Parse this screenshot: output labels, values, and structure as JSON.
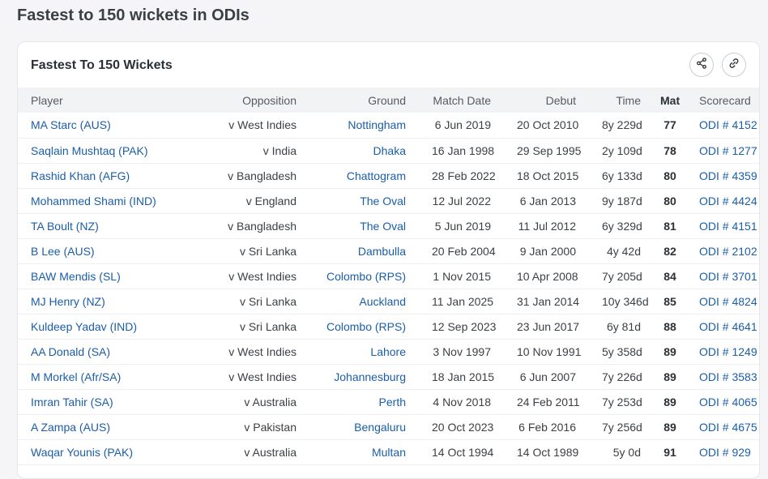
{
  "page": {
    "title": "Fastest to 150 wickets in ODIs"
  },
  "card": {
    "title": "Fastest To 150 Wickets"
  },
  "columns": {
    "player": "Player",
    "opposition": "Opposition",
    "ground": "Ground",
    "match_date": "Match Date",
    "debut": "Debut",
    "time": "Time",
    "mat": "Mat",
    "scorecard": "Scorecard"
  },
  "rows": [
    {
      "player": "MA Starc (AUS)",
      "opposition": "v West Indies",
      "ground": "Nottingham",
      "match_date": "6 Jun 2019",
      "debut": "20 Oct 2010",
      "time": "8y 229d",
      "mat": "77",
      "scorecard": "ODI # 4152"
    },
    {
      "player": "Saqlain Mushtaq (PAK)",
      "opposition": "v India",
      "ground": "Dhaka",
      "match_date": "16 Jan 1998",
      "debut": "29 Sep 1995",
      "time": "2y 109d",
      "mat": "78",
      "scorecard": "ODI # 1277"
    },
    {
      "player": "Rashid Khan (AFG)",
      "opposition": "v Bangladesh",
      "ground": "Chattogram",
      "match_date": "28 Feb 2022",
      "debut": "18 Oct 2015",
      "time": "6y 133d",
      "mat": "80",
      "scorecard": "ODI # 4359"
    },
    {
      "player": "Mohammed Shami (IND)",
      "opposition": "v England",
      "ground": "The Oval",
      "match_date": "12 Jul 2022",
      "debut": "6 Jan 2013",
      "time": "9y 187d",
      "mat": "80",
      "scorecard": "ODI # 4424"
    },
    {
      "player": "TA Boult (NZ)",
      "opposition": "v Bangladesh",
      "ground": "The Oval",
      "match_date": "5 Jun 2019",
      "debut": "11 Jul 2012",
      "time": "6y 329d",
      "mat": "81",
      "scorecard": "ODI # 4151"
    },
    {
      "player": "B Lee (AUS)",
      "opposition": "v Sri Lanka",
      "ground": "Dambulla",
      "match_date": "20 Feb 2004",
      "debut": "9 Jan 2000",
      "time": "4y 42d",
      "mat": "82",
      "scorecard": "ODI # 2102"
    },
    {
      "player": "BAW Mendis (SL)",
      "opposition": "v West Indies",
      "ground": "Colombo (RPS)",
      "match_date": "1 Nov 2015",
      "debut": "10 Apr 2008",
      "time": "7y 205d",
      "mat": "84",
      "scorecard": "ODI # 3701"
    },
    {
      "player": "MJ Henry (NZ)",
      "opposition": "v Sri Lanka",
      "ground": "Auckland",
      "match_date": "11 Jan 2025",
      "debut": "31 Jan 2014",
      "time": "10y 346d",
      "mat": "85",
      "scorecard": "ODI # 4824"
    },
    {
      "player": "Kuldeep Yadav (IND)",
      "opposition": "v Sri Lanka",
      "ground": "Colombo (RPS)",
      "match_date": "12 Sep 2023",
      "debut": "23 Jun 2017",
      "time": "6y 81d",
      "mat": "88",
      "scorecard": "ODI # 4641"
    },
    {
      "player": "AA Donald (SA)",
      "opposition": "v West Indies",
      "ground": "Lahore",
      "match_date": "3 Nov 1997",
      "debut": "10 Nov 1991",
      "time": "5y 358d",
      "mat": "89",
      "scorecard": "ODI # 1249"
    },
    {
      "player": "M Morkel (Afr/SA)",
      "opposition": "v West Indies",
      "ground": "Johannesburg",
      "match_date": "18 Jan 2015",
      "debut": "6 Jun 2007",
      "time": "7y 226d",
      "mat": "89",
      "scorecard": "ODI # 3583"
    },
    {
      "player": "Imran Tahir (SA)",
      "opposition": "v Australia",
      "ground": "Perth",
      "match_date": "4 Nov 2018",
      "debut": "24 Feb 2011",
      "time": "7y 253d",
      "mat": "89",
      "scorecard": "ODI # 4065"
    },
    {
      "player": "A Zampa (AUS)",
      "opposition": "v Pakistan",
      "ground": "Bengaluru",
      "match_date": "20 Oct 2023",
      "debut": "6 Feb 2016",
      "time": "7y 256d",
      "mat": "89",
      "scorecard": "ODI # 4675"
    },
    {
      "player": "Waqar Younis (PAK)",
      "opposition": "v Australia",
      "ground": "Multan",
      "match_date": "14 Oct 1994",
      "debut": "14 Oct 1989",
      "time": "5y 0d",
      "mat": "91",
      "scorecard": "ODI # 929"
    }
  ],
  "icons": {
    "share": "share-icon",
    "link": "link-icon"
  },
  "colors": {
    "link": "#1b5ea8",
    "header_bg": "#f2f3f5"
  }
}
